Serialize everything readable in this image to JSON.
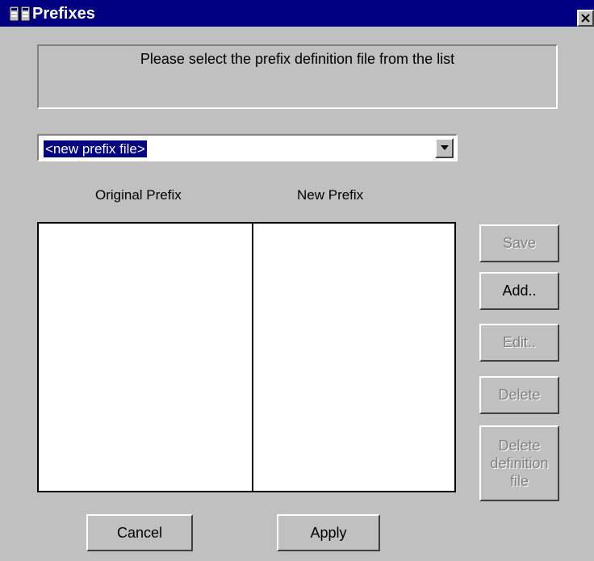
{
  "window": {
    "title": "Prefixes"
  },
  "info": {
    "text": "Please select the prefix definition file from the list"
  },
  "combo": {
    "selected": "<new prefix file>"
  },
  "columns": {
    "original": "Original Prefix",
    "new": "New Prefix"
  },
  "buttons": {
    "save": "Save",
    "add": "Add..",
    "edit": "Edit..",
    "delete": "Delete",
    "delete_def_line1": "Delete",
    "delete_def_line2": "definition file",
    "cancel": "Cancel",
    "apply": "Apply"
  },
  "states": {
    "save_enabled": false,
    "add_enabled": true,
    "edit_enabled": false,
    "delete_enabled": false,
    "delete_definition_enabled": false
  },
  "colors": {
    "titlebar": "#000080",
    "face": "#c0c0c0",
    "disabled_text": "#808080",
    "selection": "#000080"
  },
  "icons": {
    "app": "app-window-icon",
    "close": "close-icon",
    "dropdown": "dropdown-arrow-icon"
  }
}
